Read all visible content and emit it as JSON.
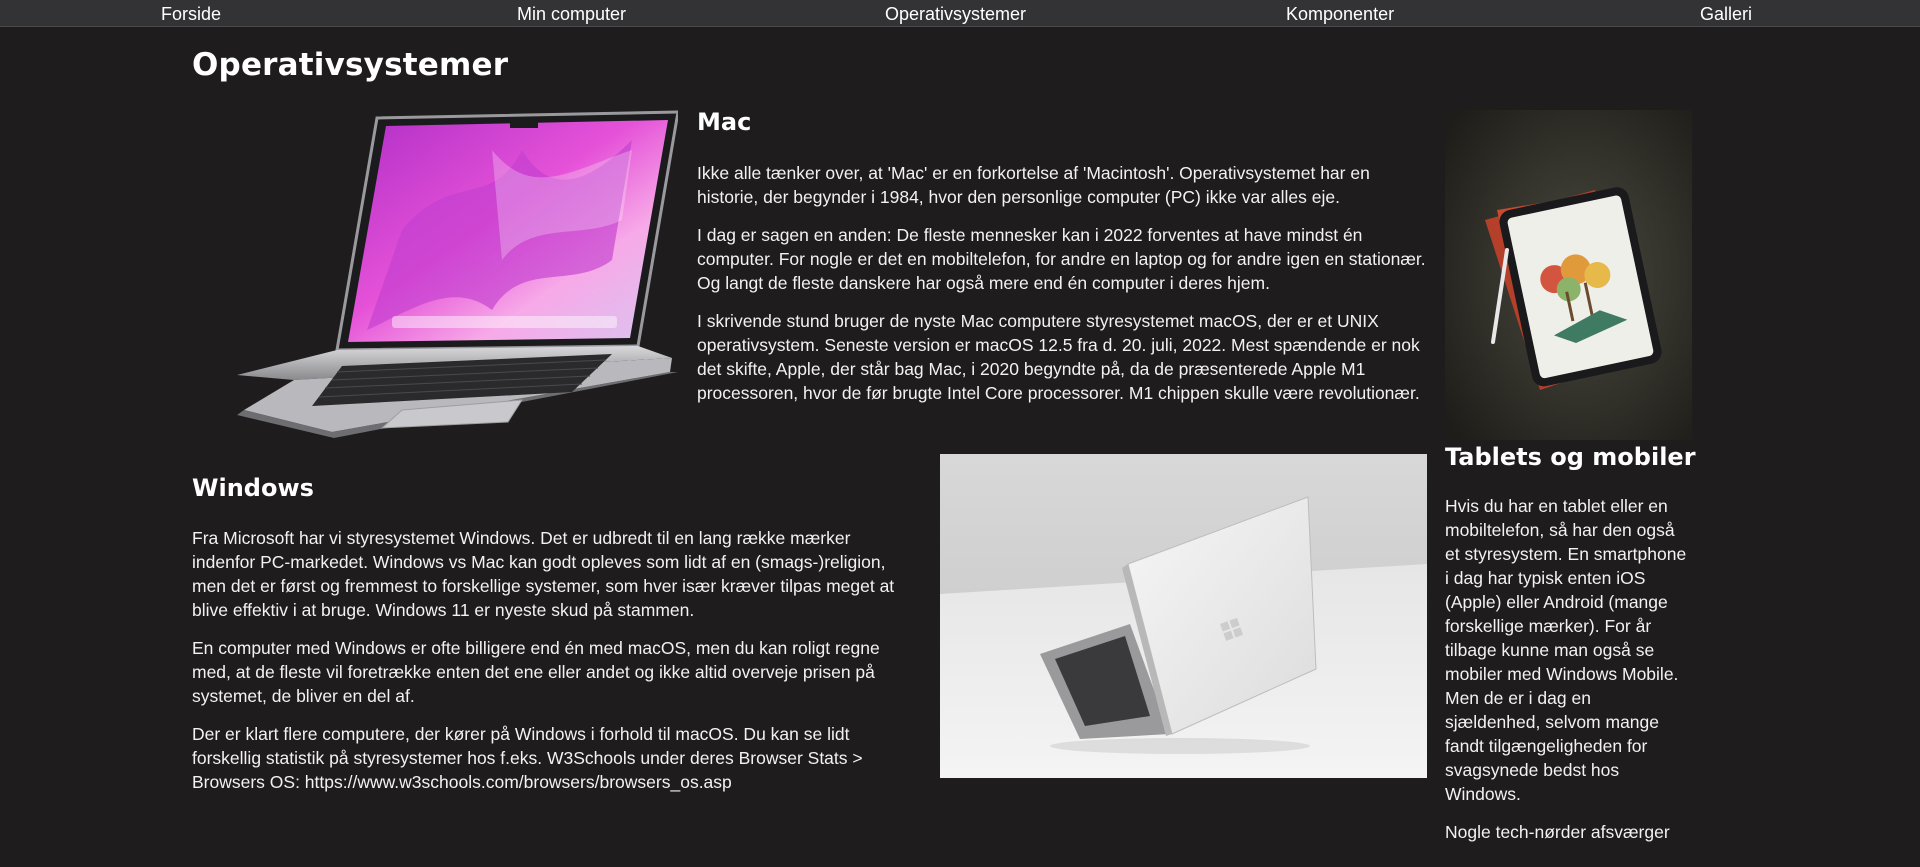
{
  "nav": {
    "items": [
      "Forside",
      "Min computer",
      "Operativsystemer",
      "Komponenter",
      "Galleri"
    ]
  },
  "page": {
    "title": "Operativsystemer"
  },
  "mac": {
    "heading": "Mac",
    "paragraphs": [
      "Ikke alle tænker over, at 'Mac' er en forkortelse af 'Macintosh'. Operativsystemet har en historie, der begynder i 1984, hvor den personlige computer (PC) ikke var alles eje.",
      "I dag er sagen en anden: De fleste mennesker kan i 2022 forventes at have mindst én computer. For nogle er det en mobiltelefon, for andre en laptop og for andre igen en stationær. Og langt de fleste danskere har også mere end én computer i deres hjem.",
      "I skrivende stund bruger de nyste Mac computere styresystemet macOS, der er et UNIX operativsystem. Seneste version er macOS 12.5 fra d. 20. juli, 2022. Mest spændende er nok det skifte, Apple, der står bag Mac, i 2020 begyndte på, da de præsenterede Apple M1 processoren, hvor de før brugte Intel Core processorer. M1 chippen skulle være revolutionær."
    ]
  },
  "windows": {
    "heading": "Windows",
    "paragraphs": [
      "Fra Microsoft har vi styresystemet Windows. Det er udbredt til en lang række mærker indenfor PC-markedet. Windows vs Mac kan godt opleves som lidt af en (smags-)religion, men det er først og fremmest to forskellige systemer, som hver især kræver tilpas meget at blive effektiv i at bruge. Windows 11 er nyeste skud på stammen.",
      "En computer med Windows er ofte billigere end én med macOS, men du kan roligt regne med, at de fleste vil foretrække enten det ene eller andet og ikke altid overveje prisen på systemet, de bliver en del af.",
      "Der er klart flere computere, der kører på Windows i forhold til macOS. Du kan se lidt forskellig statistik på styresystemer hos f.eks. W3Schools under deres Browser Stats > Browsers OS: https://www.w3schools.com/browsers/browsers_os.asp"
    ]
  },
  "tablets": {
    "heading": "Tablets og mobiler",
    "paragraphs": [
      "Hvis du har en tablet eller en mobiltelefon, så har den også et styresystem. En smartphone i dag har typisk enten iOS (Apple) eller Android (mange forskellige mærker). For år tilbage kunne man også se mobiler med Windows Mobile. Men de er i dag en sjældenhed, selvom mange fandt tilgængeligheden for svagsynede bedst hos Windows.",
      "Nogle tech-nørder afsværger"
    ]
  },
  "colors": {
    "background": "#1e1c1d",
    "nav": "#333234",
    "text": "#f2f2f2"
  }
}
